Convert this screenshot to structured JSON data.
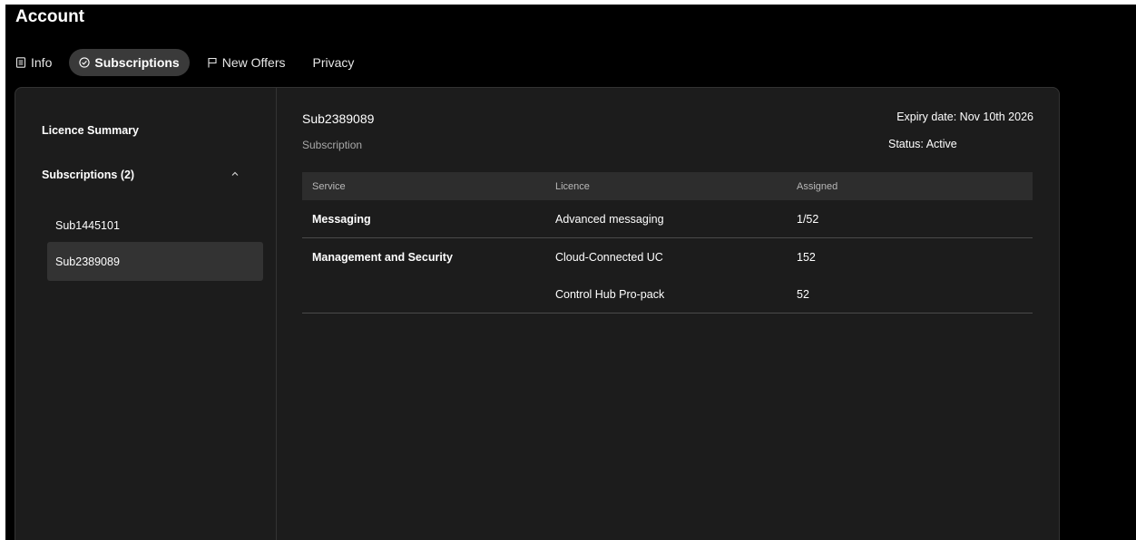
{
  "page": {
    "title": "Account"
  },
  "tabs": [
    {
      "label": "Info",
      "icon": "document-icon"
    },
    {
      "label": "Subscriptions",
      "icon": "check-circle-icon"
    },
    {
      "label": "New Offers",
      "icon": "flag-icon"
    },
    {
      "label": "Privacy",
      "icon": ""
    }
  ],
  "active_tab": "Subscriptions",
  "sidebar": {
    "summary_label": "Licence Summary",
    "subscriptions_label": "Subscriptions (2)",
    "items": [
      {
        "label": "Sub1445101"
      },
      {
        "label": "Sub2389089"
      }
    ],
    "selected": "Sub2389089"
  },
  "detail": {
    "id": "Sub2389089",
    "type": "Subscription",
    "expiry": "Expiry date: Nov 10th 2026",
    "status": "Status: Active"
  },
  "table": {
    "headers": [
      "Service",
      "Licence",
      "Assigned"
    ],
    "rows": [
      {
        "service": "Messaging",
        "licence": "Advanced messaging",
        "assigned": "1/52"
      },
      {
        "service": "Management and Security",
        "licence": "Cloud-Connected UC",
        "assigned": "152"
      },
      {
        "service": "",
        "licence": "Control Hub Pro-pack",
        "assigned": "52"
      }
    ]
  }
}
